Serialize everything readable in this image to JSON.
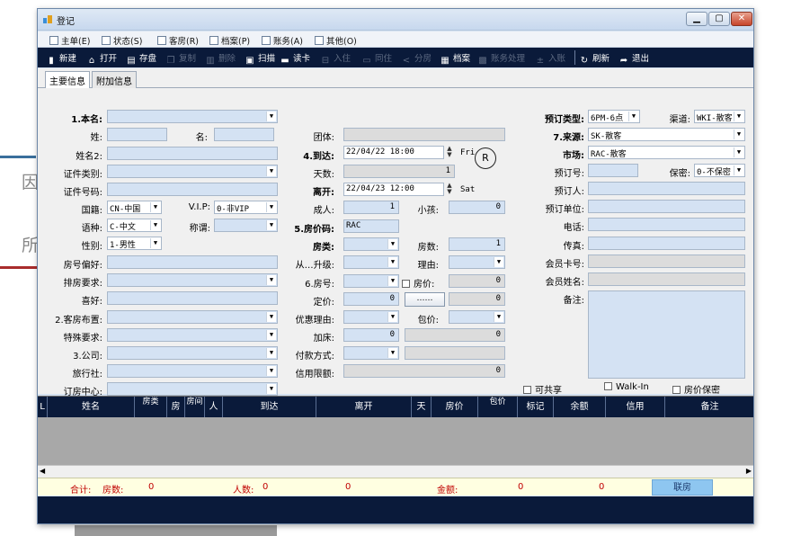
{
  "window": {
    "title": "登记"
  },
  "background": {
    "char1": "因",
    "char2": "所"
  },
  "menu": [
    "主单(E)",
    "状态(S)",
    "客房(R)",
    "档案(P)",
    "账务(A)",
    "其他(O)"
  ],
  "toolbar": {
    "new": "新建",
    "open": "打开",
    "save": "存盘",
    "copy": "复制",
    "delete": "删除",
    "scan": "扫描",
    "read_card": "读卡",
    "checkin": "入住",
    "same_room": "同住",
    "split": "分房",
    "profile": "档案",
    "billing": "账务处理",
    "enter": "入账",
    "refresh": "刷新",
    "exit": "退出"
  },
  "tabs": [
    "主要信息",
    "附加信息"
  ],
  "labels": {
    "name": "1.本名:",
    "surname": "姓:",
    "given": "名:",
    "name2": "姓名2:",
    "id_type": "证件类别:",
    "id_no": "证件号码:",
    "nation": "国籍:",
    "vip": "V.I.P:",
    "language": "语种:",
    "title": "称谓:",
    "gender": "性别:",
    "room_pref": "房号偏好:",
    "room_req": "排房要求:",
    "hobby": "喜好:",
    "layout": "2.客房布置:",
    "special": "特殊要求:",
    "company": "3.公司:",
    "agency": "旅行社:",
    "center": "订房中心:",
    "group": "团体:",
    "arrive": "4.到达:",
    "days": "天数:",
    "depart": "离开:",
    "adults": "成人:",
    "children": "小孩:",
    "rate_code": "5.房价码:",
    "room_type": "房类:",
    "rooms": "房数:",
    "upgrade": "从…升级:",
    "reason": "理由:",
    "room_no": "6.房号:",
    "rate": "房价:",
    "fixed": "定价:",
    "discount": "优惠理由:",
    "package": "包价:",
    "extra_bed": "加床:",
    "payment": "付款方式:",
    "credit": "信用限额:",
    "resv_type": "预订类型:",
    "channel": "渠道:",
    "source": "7.来源:",
    "market": "市场:",
    "resv_no": "预订号:",
    "secret": "保密:",
    "booker": "预订人:",
    "booker_unit": "预订单位:",
    "phone": "电话:",
    "fax": "传真:",
    "member_no": "会员卡号:",
    "member_name": "会员姓名:",
    "remark": "备注:"
  },
  "values": {
    "nation": "CN-中国",
    "vip": "0-非VIP",
    "language": "C-中文",
    "gender": "1-男性",
    "arrive": "22/04/22 18:00",
    "arrive_day": "Fri",
    "days": "1",
    "depart": "22/04/23 12:00",
    "depart_day": "Sat",
    "adults": "1",
    "children": "0",
    "rate_code": "RAC",
    "rooms": "1",
    "rate": "0",
    "fixed": "0",
    "package": "0",
    "extra_bed": "0",
    "credit": "0",
    "resv_type": "6PM-6点",
    "channel": "WKI-散客",
    "source": "SK-散客",
    "market": "RAC-散客",
    "secret": "0-不保密",
    "dots": "……",
    "r_mark": "R"
  },
  "checks": {
    "rate_cb": "房价:",
    "shareable": "可共享",
    "walkin": "Walk-In",
    "rate_secret": "房价保密"
  },
  "grid_headers": [
    "L",
    "姓名",
    "房类",
    "房",
    "房间",
    "人",
    "到达",
    "离开",
    "天",
    "房价",
    "包价",
    "标记",
    "余额",
    "信用",
    "备注"
  ],
  "totals": {
    "sum": "合计:",
    "rooms_label": "房数:",
    "rooms": "0",
    "persons_label": "人数:",
    "persons": "0",
    "amount1": "0",
    "amount_label": "金额:",
    "amount2": "0",
    "amount3": "0",
    "link_rooms": "联房"
  }
}
